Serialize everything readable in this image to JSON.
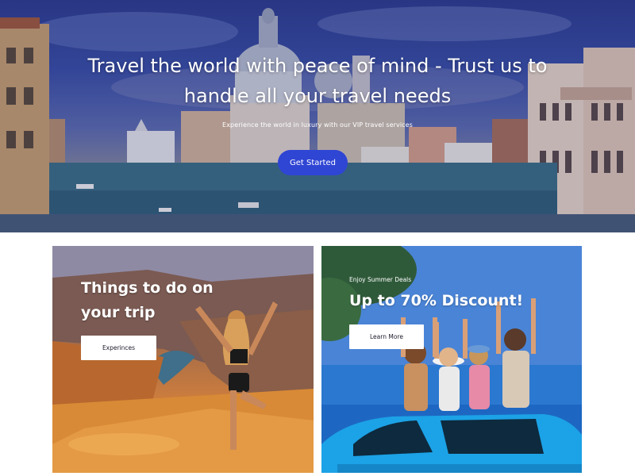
{
  "hero": {
    "title": "Travel the world with peace of mind - Trust us to handle all your travel needs",
    "subtitle": "Experience the world in luxury with our VIP travel services",
    "cta_label": "Get Started",
    "accent_color": "#2f45d4",
    "background_image": "venice-grand-canal"
  },
  "cards": {
    "left": {
      "title": "Things to do on your trip",
      "button_label": "Experinces",
      "background_image": "woman-on-canyon-cliff"
    },
    "right": {
      "kicker": "Enjoy Summer Deals",
      "title": "Up to 70% Discount!",
      "button_label": "Learn More",
      "background_image": "friends-on-car-roof-by-sea"
    }
  }
}
